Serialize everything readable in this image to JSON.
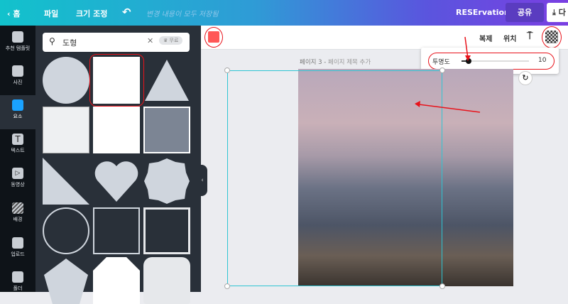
{
  "topbar": {
    "home": "홈",
    "file": "파일",
    "resize": "크기 조정",
    "save_status": "변경 내용이 모두 저장됨",
    "project_name": "RESErvation",
    "share": "공유",
    "download": "다"
  },
  "sidebar": {
    "items": [
      {
        "label": "추천 템플릿"
      },
      {
        "label": "사진"
      },
      {
        "label": "요소"
      },
      {
        "label": "텍스트"
      },
      {
        "label": "동영상"
      },
      {
        "label": "배경"
      },
      {
        "label": "업로드"
      },
      {
        "label": "폴더"
      }
    ]
  },
  "panel": {
    "search_value": "도형",
    "free_badge": "무료"
  },
  "toolbar": {
    "duplicate": "복제",
    "position": "위치",
    "color": "#ff5757"
  },
  "transparency": {
    "label": "투명도",
    "value": "10",
    "fraction": 0.1
  },
  "page": {
    "title": "페이지 3 - ",
    "title_placeholder": "페이지 제목 추가"
  }
}
